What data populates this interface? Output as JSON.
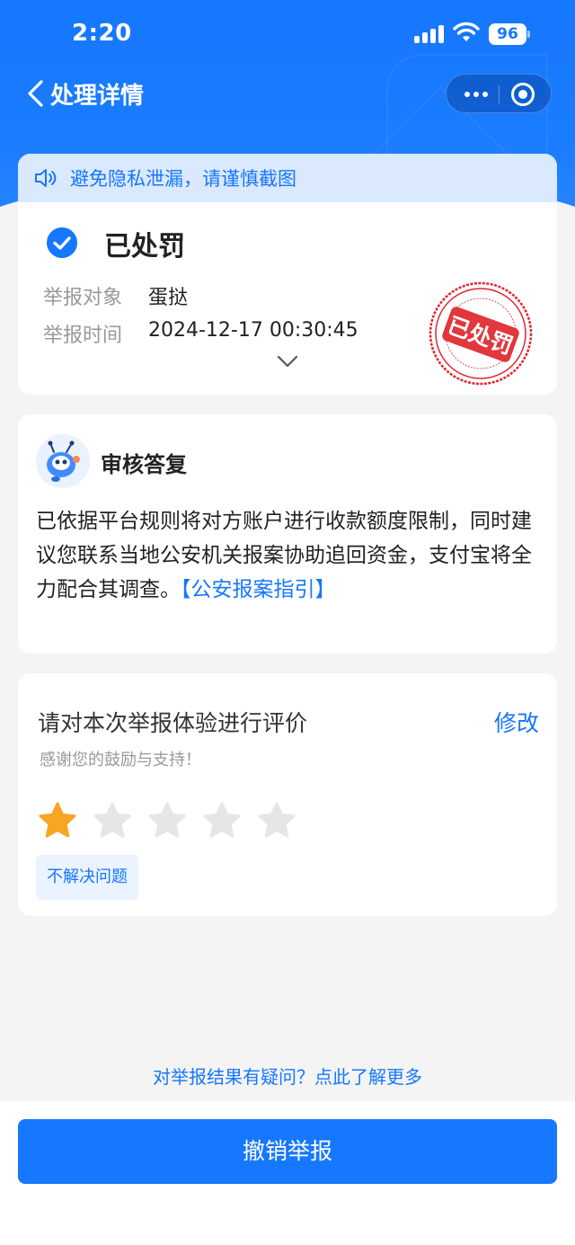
{
  "status_bar": {
    "time": "2:20",
    "battery": "96"
  },
  "nav": {
    "title": "处理详情"
  },
  "notice": {
    "text": "避免隐私泄漏，请谨慎截图"
  },
  "result": {
    "status": "已处罚",
    "rows": [
      {
        "label": "举报对象",
        "value": "蛋挞"
      },
      {
        "label": "举报时间",
        "value": "2024-12-17 00:30:45"
      }
    ],
    "stamp_text": "已处罚"
  },
  "review": {
    "title": "审核答复",
    "body": "已依据平台规则将对方账户进行收款额度限制，同时建议您联系当地公安机关报案协助追回资金，支付宝将全力配合其调查。",
    "link": "【公安报案指引】"
  },
  "rating": {
    "title": "请对本次举报体验进行评价",
    "edit": "修改",
    "subtitle": "感谢您的鼓励与支持！",
    "stars": 1,
    "max_stars": 5,
    "tag": "不解决问题",
    "colors": {
      "active": "#f7a523",
      "inactive": "#e6e6e6"
    }
  },
  "help_link": "对举报结果有疑问？点此了解更多",
  "cancel_button": "撤销举报",
  "colors": {
    "primary": "#1677ff",
    "stamp": "#e0262d"
  }
}
